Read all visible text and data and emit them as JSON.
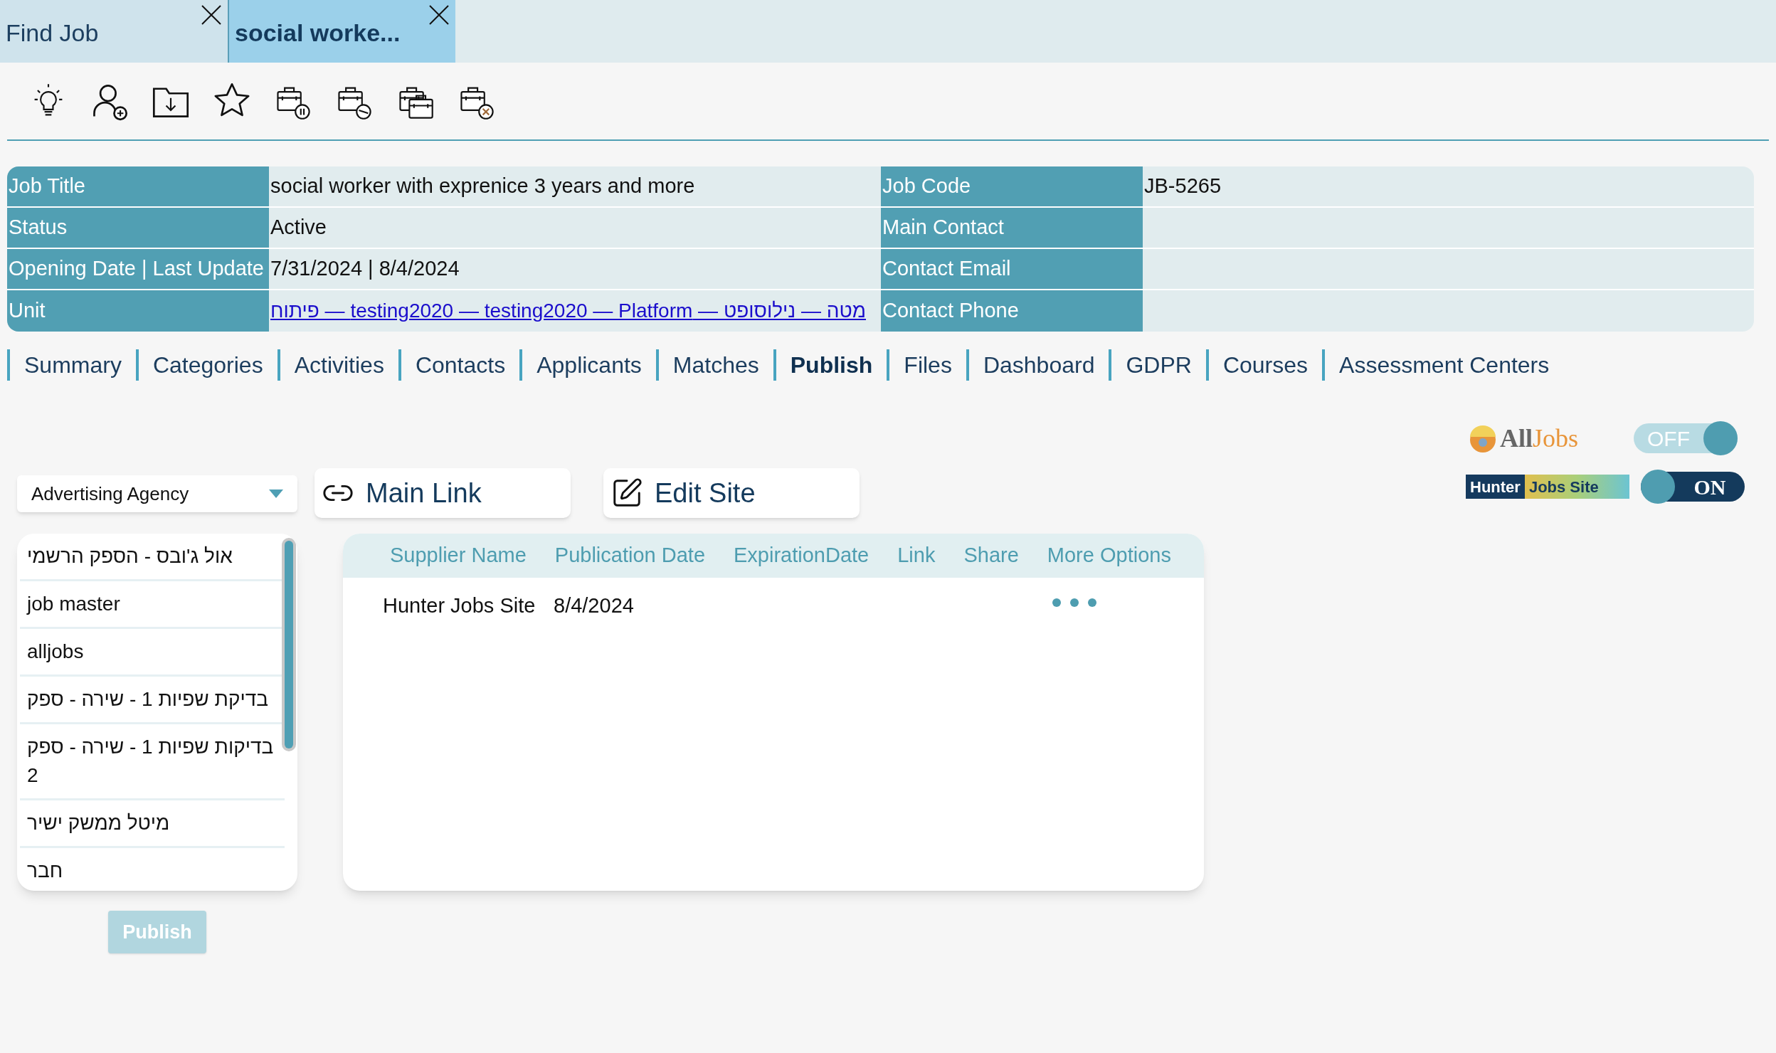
{
  "tabs": [
    {
      "label": "Find Job",
      "selected": false
    },
    {
      "label": "social worke...",
      "selected": true
    }
  ],
  "info_rows": [
    [
      {
        "label": "Job Title",
        "value": "social worker with exprenice 3 years and more",
        "kind": "text"
      },
      {
        "label": "Job Code",
        "value": "JB-5265",
        "kind": "text"
      }
    ],
    [
      {
        "label": "Status",
        "value": "Active",
        "kind": "text"
      },
      {
        "label": "Main Contact"
      }
    ],
    [
      {
        "label": "Opening Date | Last Update",
        "value": "7/31/2024 | 8/4/2024",
        "kind": "text"
      },
      {
        "label": "Contact Email"
      }
    ],
    [
      {
        "label": "Unit",
        "value": "מטה — נילוסופט — testing2020 — testing2020 — Platform — פיתוח",
        "kind": "link"
      },
      {
        "label": "Contact Phone"
      }
    ]
  ],
  "nav_tabs": [
    {
      "label": "Summary",
      "selected": false
    },
    {
      "label": "Categories",
      "selected": false
    },
    {
      "label": "Activities",
      "selected": false
    },
    {
      "label": "Contacts",
      "selected": false
    },
    {
      "label": "Applicants",
      "selected": false
    },
    {
      "label": "Matches",
      "selected": false
    },
    {
      "label": "Publish",
      "selected": true
    },
    {
      "label": "Files",
      "selected": false
    },
    {
      "label": "Dashboard",
      "selected": false
    },
    {
      "label": "GDPR",
      "selected": false
    },
    {
      "label": "Courses",
      "selected": false
    },
    {
      "label": "Assessment Centers",
      "selected": false
    }
  ],
  "site_toggles": [
    {
      "kind": "alljobs",
      "logo_parts": [
        "All",
        "Jobs"
      ],
      "on": false,
      "label": "OFF"
    },
    {
      "kind": "hunter",
      "logo_parts": [
        "Hunter",
        "Jobs Site"
      ],
      "on": true,
      "label": "ON"
    }
  ],
  "agency_dropdown": {
    "value": "Advertising Agency"
  },
  "buttons": [
    {
      "kind": "link",
      "label": "Main Link"
    },
    {
      "kind": "edit",
      "label": "Edit Site"
    }
  ],
  "suppliers": [
    "אול ג'ובס - הספק הרשמי",
    "job master",
    "alljobs",
    "בדיקת שפיות 1 - שירה - ספק",
    "בדיקות שפיות 1 - שירה - ספק 2",
    "מיטל ממשק ישיר",
    "חבר"
  ],
  "publish_button": {
    "label": "Publish",
    "disabled": true
  },
  "publications": {
    "columns": [
      "Supplier Name",
      "Publication Date",
      "ExpirationDate",
      "Link",
      "Share",
      "More Options"
    ],
    "rows": [
      {
        "supplier": "Hunter Jobs Site",
        "publication_date": "8/4/2024"
      }
    ]
  }
}
